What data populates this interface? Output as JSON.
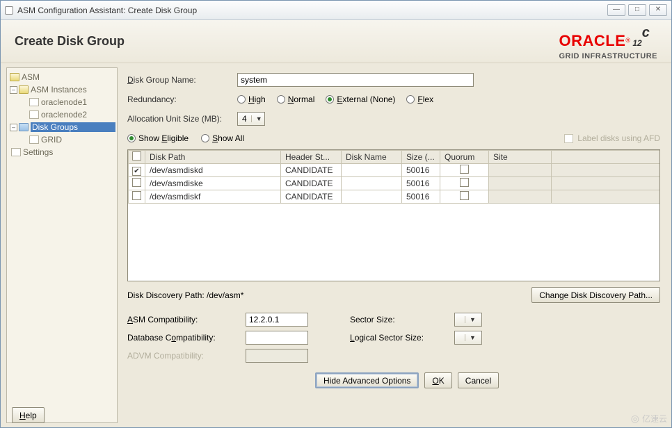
{
  "win_title": "ASM Configuration Assistant: Create Disk Group",
  "win_btns": {
    "min": "—",
    "max": "□",
    "close": "✕"
  },
  "page_title": "Create Disk Group",
  "oracle": {
    "brand": "ORACLE",
    "sub": "GRID INFRASTRUCTURE",
    "ver": "12",
    "sup": "c"
  },
  "tree": {
    "root": "ASM",
    "inst": "ASM Instances",
    "n1": "oraclenode1",
    "n2": "oraclenode2",
    "dg": "Disk Groups",
    "grid": "GRID",
    "settings": "Settings"
  },
  "form": {
    "dg_name_lbl": "Disk Group Name:",
    "dg_name_val": "system",
    "redund_lbl": "Redundancy:",
    "r_high": "High",
    "r_normal": "Normal",
    "r_ext": "External (None)",
    "r_flex": "Flex",
    "au_lbl": "Allocation Unit Size (MB):",
    "au_val": "4",
    "show_elig": "Show Eligible",
    "show_all": "Show All",
    "afd_lbl": "Label disks using AFD",
    "cols": {
      "path": "Disk Path",
      "hdr": "Header St...",
      "name": "Disk Name",
      "size": "Size (...",
      "quorum": "Quorum",
      "site": "Site"
    },
    "rows": [
      {
        "sel": true,
        "path": "/dev/asmdiskd",
        "hdr": "CANDIDATE",
        "name": "",
        "size": "50016",
        "quorum": false,
        "site": ""
      },
      {
        "sel": false,
        "path": "/dev/asmdiske",
        "hdr": "CANDIDATE",
        "name": "",
        "size": "50016",
        "quorum": false,
        "site": ""
      },
      {
        "sel": false,
        "path": "/dev/asmdiskf",
        "hdr": "CANDIDATE",
        "name": "",
        "size": "50016",
        "quorum": false,
        "site": ""
      }
    ],
    "disc_lbl": "Disk Discovery Path:",
    "disc_val": "/dev/asm*",
    "disc_btn": "Change Disk Discovery Path...",
    "asm_comp_lbl": "ASM Compatibility:",
    "asm_comp_val": "12.2.0.1",
    "db_comp_lbl": "Database Compatibility:",
    "db_comp_val": "",
    "advm_comp_lbl": "ADVM Compatibility:",
    "advm_comp_val": "",
    "sector_lbl": "Sector Size:",
    "lsector_lbl": "Logical Sector Size:",
    "hide_adv": "Hide Advanced Options",
    "ok": "OK",
    "cancel": "Cancel",
    "help": "Help"
  },
  "watermark": "亿速云"
}
